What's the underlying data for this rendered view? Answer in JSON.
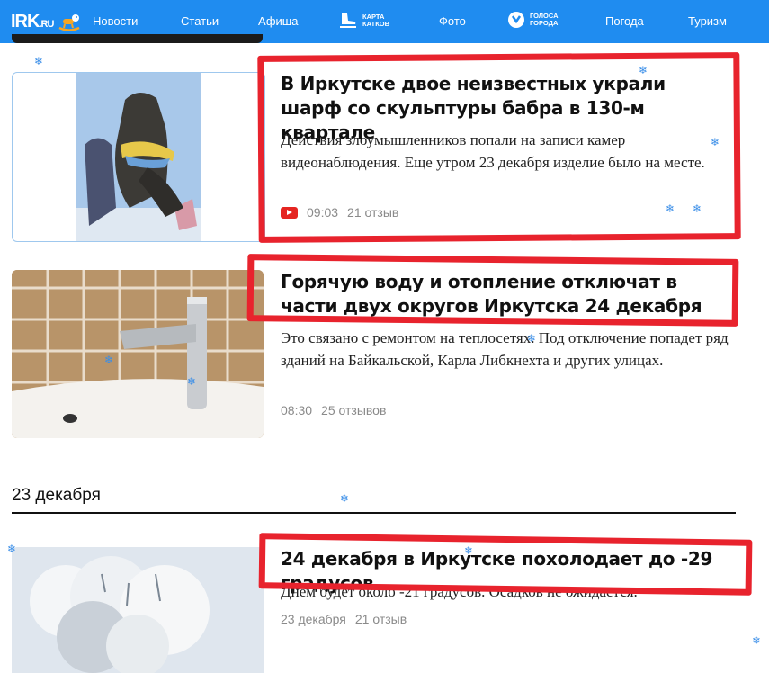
{
  "header": {
    "logo_main": "IRK",
    "logo_suffix": ".RU",
    "nav": [
      {
        "label": "Новости",
        "active": true
      },
      {
        "label": "Статьи"
      },
      {
        "label": "Афиша"
      },
      {
        "label": "КАРТА\nКАТКОВ",
        "icon": "skate-icon"
      },
      {
        "label": "Фото"
      },
      {
        "label": "ГОЛОСА\nГОРОДА",
        "icon": "voice-icon"
      },
      {
        "label": "Погода"
      },
      {
        "label": "Туризм"
      }
    ]
  },
  "articles": [
    {
      "title": "В Иркутске двое неизвестных украли шарф со скульптуры бабра в 130-м квартале",
      "lead": "Действия злоумышленников попали на записи камер видеонаблюдения. Еще утром 23 декабря изделие было на месте.",
      "time": "09:03",
      "comments": "21 отзыв",
      "video": true,
      "image": "babr-statue-with-scarf"
    },
    {
      "title": "Горячую воду и отопление отключат в части двух округов Иркутска 24 декабря",
      "lead": "Это связано с ремонтом на теплосетях. Под отключение попадет ряд зданий на Байкальской, Карла Либкнехта и других улицах.",
      "time": "08:30",
      "comments": "25 отзывов",
      "image": "faucet-and-sink"
    }
  ],
  "date_section": {
    "label": "23 декабря"
  },
  "articles_2": [
    {
      "title": "24 декабря в Иркутске похолодает до -29 градусов",
      "lead": "Днем будет около -21 градусов. Осадков не ожидается.",
      "time": "23 декабря",
      "comments": "21 отзыв",
      "image": "frosty-tree"
    }
  ],
  "colors": {
    "header_bg": "#1f8cf0",
    "highlight": "#e8232d",
    "meta_text": "#8a8a8a",
    "snowflake": "#3a8ee8"
  }
}
